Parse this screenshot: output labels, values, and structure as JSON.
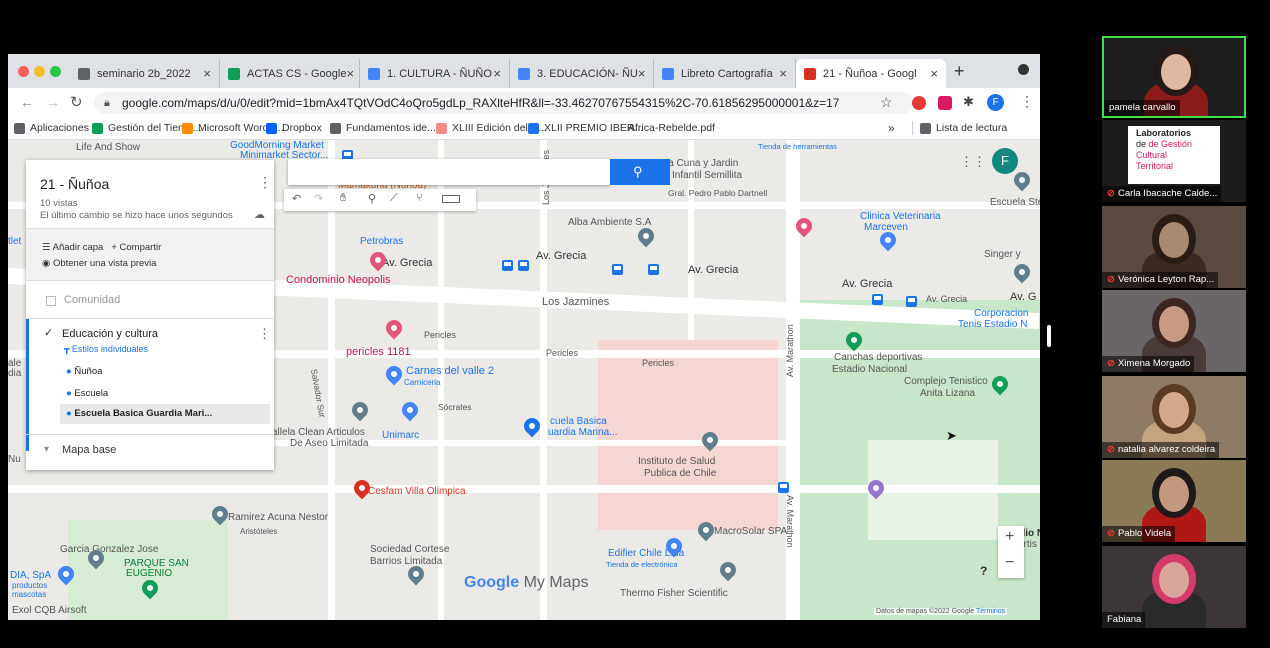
{
  "browser": {
    "tabs": [
      {
        "label": "seminario 2b_2022",
        "color": "#5f6368"
      },
      {
        "label": "ACTAS CS - Google",
        "color": "#0f9d58"
      },
      {
        "label": "1. CULTURA - ÑUÑO",
        "color": "#4285f4"
      },
      {
        "label": "3. EDUCACIÓN- ÑU",
        "color": "#4285f4"
      },
      {
        "label": "Libreto Cartografía",
        "color": "#4285f4"
      },
      {
        "label": "21 - Ñuñoa - Googl",
        "color": "#d93025"
      }
    ],
    "url": "google.com/maps/d/u/0/edit?mid=1bmAx4TQtVOdC4oQro5gdLp_RAXlteHfR&ll=-33.46270767554315%2C-70.61856295000001&z=17",
    "profile_letter": "F",
    "bookmarks": [
      {
        "label": "Aplicaciones",
        "color": "#5f6368"
      },
      {
        "label": "Gestión del Tiemp...",
        "color": "#0f9d58"
      },
      {
        "label": "Microsoft Word -...",
        "color": "#ff8c00"
      },
      {
        "label": "Dropbox",
        "color": "#0061ff"
      },
      {
        "label": "Fundamentos ide...",
        "color": "#5f6368"
      },
      {
        "label": "XLIII Edición del C...",
        "color": "#f28b82"
      },
      {
        "label": "XLII PREMIO IBER...",
        "color": "#1a73e8"
      },
      {
        "label": "Africa-Rebelde.pdf",
        "color": "#ffffff"
      }
    ],
    "bookmarks_more": "»",
    "reading_list": "Lista de lectura"
  },
  "mymaps": {
    "title": "21 - Ñuñoa",
    "views": "10 vistas",
    "last_change": "El último cambio se hizo hace unos segundos",
    "add_layer": "Añadir capa",
    "share": "Compartir",
    "preview": "Obtener una vista previa",
    "layers": [
      {
        "name": "Comunidad",
        "checked": false
      },
      {
        "name": "Educación y cultura",
        "checked": true
      }
    ],
    "styles_link": "Estilos individuales",
    "items": [
      "Ñuñoa",
      "Escuela",
      "Escuela Basica Guardia Mari..."
    ],
    "base_map": "Mapa base",
    "avatar_letter": "F",
    "watermark_google": "Google",
    "watermark_product": "My Maps",
    "attribution": "Datos de mapas ©2022 Google",
    "terms": "Términos",
    "zoom_in": "+",
    "zoom_out": "−",
    "help": "?"
  },
  "map_labels": {
    "life_and_show": "Life And Show",
    "goodmorning": "GoodMorning Market",
    "minimarket": "Minimarket Sector...",
    "mamakuna": "Mamakuna (Ñuñoa)",
    "sala_cuna": "la Cuna y Jardin",
    "infantil": "Infantil Semillita",
    "pedro_pablo": "Gral. Pedro Pablo Dartnell",
    "comunicate": "Tienda de herramientas",
    "escuela_stella": "Escuela Stella M",
    "clinica": "Clinica Veterinaria",
    "marceven": "Marceven",
    "alba": "Alba Ambiente S.A",
    "petrobras": "Petrobras",
    "av_grecia_1": "Av. Grecia",
    "av_grecia_2": "Av. Grecia",
    "av_grecia_3": "Av. Grecia",
    "av_grecia_4": "Av. Grecia",
    "av_grecia_5": "Av. Grecia",
    "av_grecia_6": "Av. G",
    "singer": "Singer y",
    "condominio": "Condominio Neopolis",
    "los_jazmines": "Los Jazmines",
    "los_jazmines_st": "Los Jazmines",
    "corporacion": "Corporacion",
    "tenis": "Tenis Estadio N",
    "pericles_1": "Pericles",
    "pericles_2": "Pericles",
    "pericles_3": "Pericles",
    "pericles_1181": "pericles 1181",
    "carnes": "Carnes del valle 2",
    "carniceria": "Carniceria",
    "canchas": "Canchas deportivas",
    "estadio": "Estadio Nacional",
    "complejo": "Complejo Tenistico",
    "anita": "Anita Lizana",
    "salvador_sur": "Salvador Sur",
    "socrates": "Sócrates",
    "av_marathon_1": "Av. Marathon",
    "av_marathon_2": "Av. Marathon",
    "escuela_basica": "cuela Basica",
    "guardia": "uardia Marina...",
    "clean": "allela Clean Articulos",
    "aseo": "De Aseo Limitada",
    "unimarc": "Unimarc",
    "instituto": "Instituto de Salud",
    "publica": "Publica de Chile",
    "cesfam": "Cesfam Villa Olimpica",
    "ramirez": "Ramirez Acuna Nestor",
    "aristoteles": "Aristóteles",
    "macrosolar": "MacroSolar SPA",
    "garcia": "Garcia Gonzalez Jose",
    "parque": "PARQUE SAN",
    "eugenio": "EUGENIO",
    "sociedad": "Sociedad Cortese",
    "barrios": "Barrios Limitada",
    "edifier": "Edifier Chile Ltda",
    "electronica": "Tienda de electrónica",
    "thermo": "Thermo Fisher Scientific",
    "estadio_n": "Estadio N",
    "artis": "artis",
    "exol": "Exol CQB Airsoft",
    "dia": "DIA, SpA",
    "productos": "productos",
    "mascotas": "mascotas",
    "tlet": "tlet",
    "ale": "ale",
    "dia_left": "dia",
    "nu_left": "Nu"
  },
  "participants": [
    {
      "name": "pamela carvallo",
      "muted": false,
      "bg": "#1e1e1e",
      "shirt": "#8b1a1a",
      "skin": "#e0b7a0",
      "hair": "#241a18"
    },
    {
      "name": "Carla Ibacache Calde...",
      "muted": true,
      "logo_line1": "Laboratorios",
      "logo_line2": "de Gestión",
      "logo_line3": "Cultural",
      "logo_line4": "Territorial"
    },
    {
      "name": "Verónica Leyton Rap...",
      "muted": true,
      "bg": "#5a4a40",
      "shirt": "#3a2a22",
      "skin": "#a98a70",
      "hair": "#2a1c14"
    },
    {
      "name": "Ximena Morgado",
      "muted": true,
      "bg": "#6a6566",
      "shirt": "#4a3b3b",
      "skin": "#c89a82",
      "hair": "#3b2622"
    },
    {
      "name": "natalia alvarez coldeira",
      "muted": true,
      "bg": "#8f7a63",
      "shirt": "#c4a47e",
      "skin": "#d4a88a",
      "hair": "#5b3a22"
    },
    {
      "name": "Pablo Videla",
      "muted": true,
      "bg": "#8a7a55",
      "shirt": "#b01818",
      "skin": "#c2987e",
      "hair": "#1e1a18"
    },
    {
      "name": "Fabiana",
      "muted": false,
      "bg": "#3c3638",
      "shirt": "#2a2a2a",
      "skin": "#d7a59a",
      "hair": "#d43a6a"
    }
  ]
}
